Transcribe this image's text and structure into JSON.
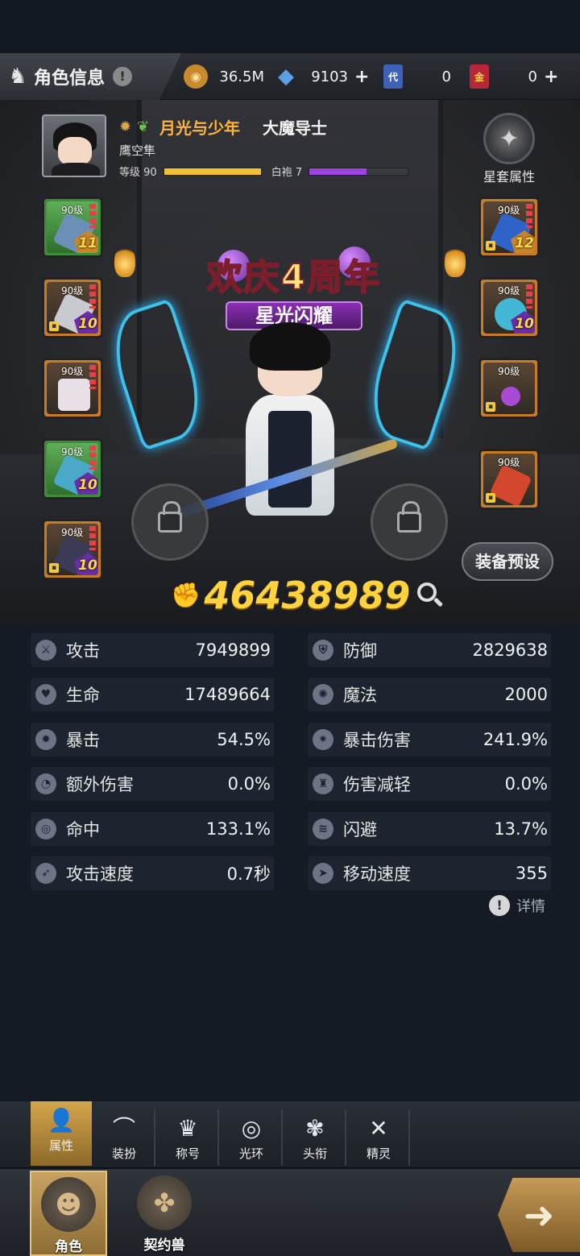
{
  "header": {
    "title": "角色信息",
    "help_icon": "!",
    "currencies": [
      {
        "name": "gold-coin",
        "value": "36.5M",
        "icon_text": "◉",
        "color": "#c98a2e"
      },
      {
        "name": "diamond",
        "value": "9103",
        "icon_text": "◆",
        "color": "#5aa0e8",
        "has_plus": true
      },
      {
        "name": "ticket-blue",
        "value": "0",
        "icon_text": "代",
        "color": "#3d62b8"
      },
      {
        "name": "ticket-gold",
        "value": "0",
        "icon_text": "金",
        "color": "#b8263a",
        "has_plus": true
      }
    ],
    "plus": "+"
  },
  "profile": {
    "guild": "月光与少年",
    "class_name": "大魔导士",
    "player_name": "鹰空隼",
    "level_label": "等级 90",
    "level_progress": 1.0,
    "rank_label": "白袍 7",
    "rank_progress": 0.58,
    "level_color": "#f2c232",
    "rank_color": "#9a45e0"
  },
  "star_set": {
    "label": "星套属性"
  },
  "equipment": {
    "left": [
      {
        "level": "90级",
        "enhance": "11",
        "rarity": "green",
        "locked": false,
        "color": "#6b8fb5"
      },
      {
        "level": "90级",
        "enhance": "10",
        "rarity": "orange",
        "locked": true,
        "color": "#c9c9d2"
      },
      {
        "level": "90级",
        "enhance": "",
        "rarity": "orange",
        "locked": false,
        "color": "#e8e0e6"
      },
      {
        "level": "90级",
        "enhance": "10",
        "rarity": "green",
        "locked": false,
        "color": "#4aa9c9"
      },
      {
        "level": "90级",
        "enhance": "10",
        "rarity": "orange",
        "locked": true,
        "color": "#3b3b58"
      }
    ],
    "right": [
      {
        "level": "90级",
        "enhance": "12",
        "rarity": "orange",
        "locked": true,
        "color": "#2f63c8"
      },
      {
        "level": "90级",
        "enhance": "10",
        "rarity": "orange",
        "locked": false,
        "color": "#43b8d6"
      },
      {
        "level": "90级",
        "enhance": "",
        "rarity": "orange",
        "locked": true,
        "color": "#a94ad6"
      },
      {
        "level": "90级",
        "enhance": "",
        "rarity": "orange",
        "locked": true,
        "color": "#d4472f"
      }
    ]
  },
  "banner": {
    "main": "欢庆4周年",
    "sub": "星光闪耀"
  },
  "preset_button": "装备预设",
  "power": {
    "value": "46438989"
  },
  "stats": [
    {
      "label": "攻击",
      "value": "7949899",
      "icon": "sword-icon"
    },
    {
      "label": "防御",
      "value": "2829638",
      "icon": "shield-icon"
    },
    {
      "label": "生命",
      "value": "17489664",
      "icon": "heart-icon"
    },
    {
      "label": "魔法",
      "value": "2000",
      "icon": "magic-icon"
    },
    {
      "label": "暴击",
      "value": "54.5%",
      "icon": "crit-icon"
    },
    {
      "label": "暴击伤害",
      "value": "241.9%",
      "icon": "crit-damage-icon"
    },
    {
      "label": "额外伤害",
      "value": "0.0%",
      "icon": "extra-damage-icon"
    },
    {
      "label": "伤害减轻",
      "value": "0.0%",
      "icon": "damage-reduction-icon"
    },
    {
      "label": "命中",
      "value": "133.1%",
      "icon": "target-icon"
    },
    {
      "label": "闪避",
      "value": "13.7%",
      "icon": "dodge-icon"
    },
    {
      "label": "攻击速度",
      "value": "0.7秒",
      "icon": "attack-speed-icon"
    },
    {
      "label": "移动速度",
      "value": "355",
      "icon": "move-speed-icon"
    }
  ],
  "detail_link": {
    "label": "详情",
    "icon_text": "!"
  },
  "sub_tabs": [
    {
      "label": "属性",
      "icon": "👤",
      "active": true
    },
    {
      "label": "装扮",
      "icon": "⌒",
      "active": false
    },
    {
      "label": "称号",
      "icon": "♛",
      "active": false
    },
    {
      "label": "光环",
      "icon": "◎",
      "active": false
    },
    {
      "label": "头衔",
      "icon": "✾",
      "active": false
    },
    {
      "label": "精灵",
      "icon": "✕",
      "active": false
    }
  ],
  "bottom_nav": [
    {
      "label": "角色",
      "active": true
    },
    {
      "label": "契约兽",
      "active": false
    }
  ],
  "arrow": "➜"
}
